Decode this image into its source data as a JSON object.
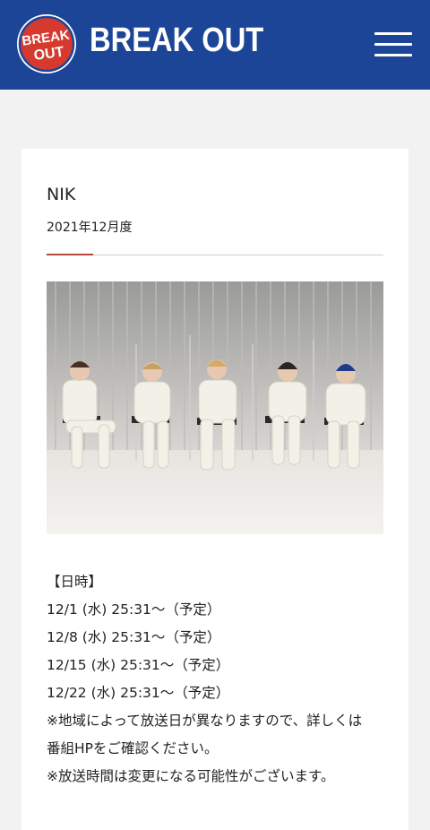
{
  "header": {
    "logo_text_top": "BREAK",
    "logo_text_bottom": "OUT",
    "site_title": "BREAK OUT",
    "menu_icon": "hamburger-menu-icon",
    "colors": {
      "header_bg": "#1d4597",
      "logo_red": "#d63a2f"
    }
  },
  "article": {
    "title": "NIK",
    "month": "2021年12月度",
    "schedule_heading": "【日時】",
    "schedule": [
      "12/1 (水) 25:31～（予定）",
      "12/8 (水) 25:31～（予定）",
      "12/15 (水) 25:31～（予定）",
      "12/22 (水) 25:31～（予定）"
    ],
    "notes": [
      "※地域によって放送日が異なりますので、詳しくは",
      "番組HPをご確認ください。",
      "※放送時間は変更になる可能性がございます。"
    ]
  }
}
